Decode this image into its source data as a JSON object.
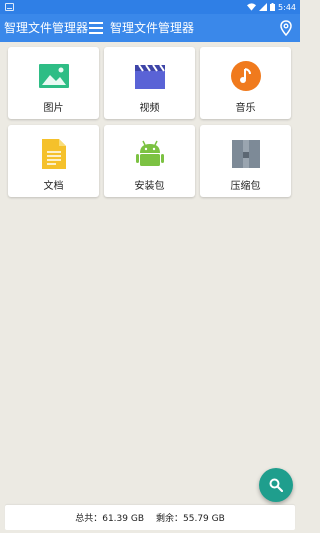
{
  "status_bar": {
    "time": "5:44"
  },
  "app_bar": {
    "title_left": "智理文件管理器",
    "title_main": "智理文件管理器"
  },
  "categories": [
    {
      "label": "图片",
      "icon": "image-icon",
      "color": "#2ebd85"
    },
    {
      "label": "视频",
      "icon": "video-clapper-icon",
      "color": "#5a63d6"
    },
    {
      "label": "音乐",
      "icon": "music-note-icon",
      "color": "#f07a1d"
    },
    {
      "label": "文档",
      "icon": "document-icon",
      "color": "#f5c12b"
    },
    {
      "label": "安装包",
      "icon": "android-icon",
      "color": "#7cc242"
    },
    {
      "label": "压缩包",
      "icon": "archive-icon",
      "color": "#7d8a97"
    }
  ],
  "storage": {
    "total_label": "总共：",
    "total_value": "61.39 GB",
    "free_label": "剩余：",
    "free_value": "55.79 GB"
  },
  "colors": {
    "status_bar": "#2f7fe6",
    "app_bar": "#3a88ea",
    "background": "#eceae3",
    "fab": "#1f9e8d"
  }
}
